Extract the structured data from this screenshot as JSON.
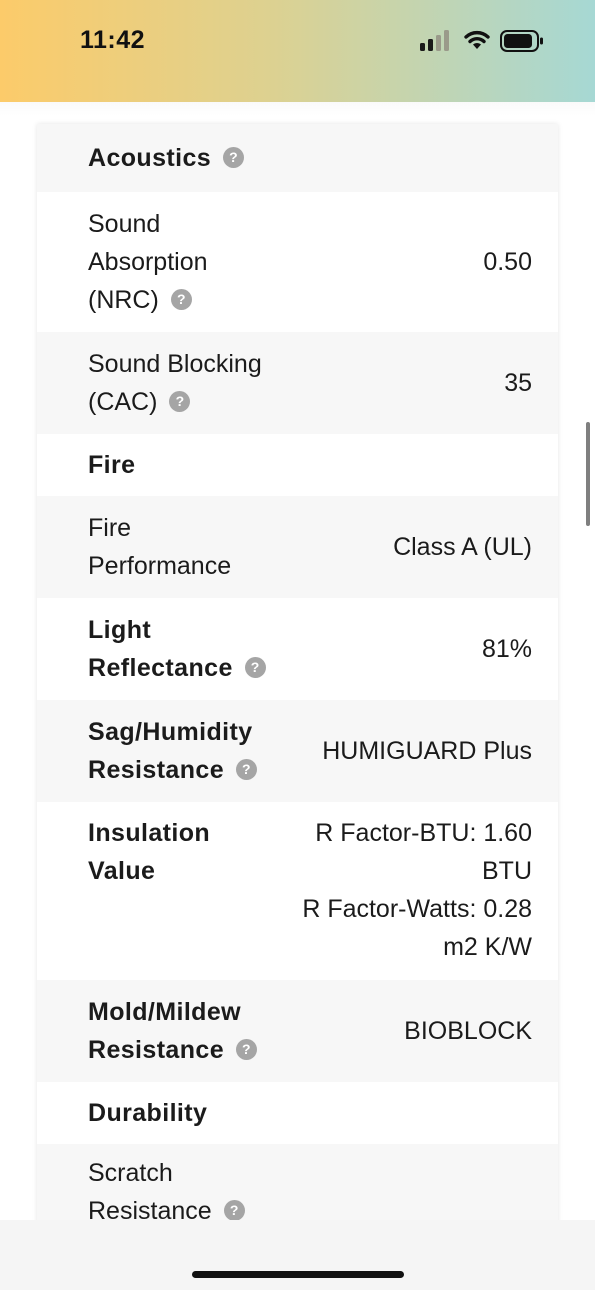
{
  "status_bar": {
    "time": "11:42"
  },
  "sections": {
    "acoustics": "Acoustics",
    "fire": "Fire",
    "durability": "Durability"
  },
  "rows": {
    "nrc": {
      "label": "Sound Absorption (NRC)",
      "value": "0.50"
    },
    "cac": {
      "label": "Sound Blocking (CAC)",
      "value": "35"
    },
    "fire_perf": {
      "label": "Fire Performance",
      "value": "Class A (UL)"
    },
    "light": {
      "label": "Light Reflectance",
      "value": "81%"
    },
    "sag": {
      "label": "Sag/Humidity Resistance",
      "value": "HUMIGUARD Plus"
    },
    "insulation": {
      "label": "Insulation Value",
      "value_line1": "R Factor-BTU: 1.60 BTU",
      "value_line2": "R Factor-Watts: 0.28 m2 K/W"
    },
    "mold": {
      "label": "Mold/Mildew Resistance",
      "value": "BIOBLOCK"
    },
    "scratch": {
      "label": "Scratch Resistance"
    }
  },
  "help_glyph": "?",
  "colors": {
    "help_icon": "#a5a5a5",
    "row_shade": "#f7f7f7"
  }
}
